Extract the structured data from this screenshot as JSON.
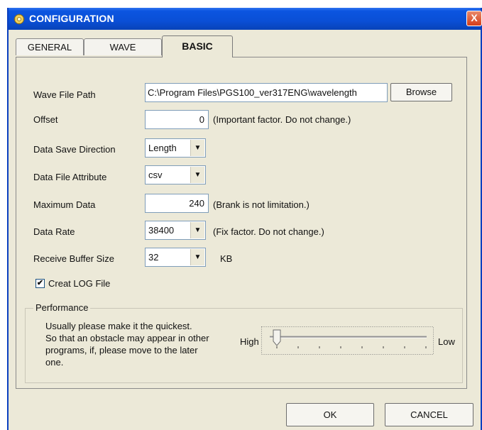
{
  "window": {
    "title": "CONFIGURATION",
    "close_label": "X"
  },
  "tabs": [
    {
      "label": "GENERAL"
    },
    {
      "label": "WAVE"
    },
    {
      "label": "BASIC",
      "active": true
    }
  ],
  "basic": {
    "wave_file_path": {
      "label": "Wave File Path",
      "value": "C:\\Program Files\\PGS100_ver317ENG\\wavelength",
      "browse_label": "Browse"
    },
    "offset": {
      "label": "Offset",
      "value": "0",
      "note": "(Important factor. Do not change.)"
    },
    "data_save_direction": {
      "label": "Data Save Direction",
      "value": "Length"
    },
    "data_file_attribute": {
      "label": "Data File Attribute",
      "value": "csv"
    },
    "maximum_data": {
      "label": "Maximum Data",
      "value": "240",
      "note": "(Brank is not limitation.)"
    },
    "data_rate": {
      "label": "Data Rate",
      "value": "38400",
      "note": "(Fix factor. Do not change.)"
    },
    "receive_buffer_size": {
      "label": "Receive Buffer Size",
      "value": "32",
      "unit": "KB"
    },
    "create_log": {
      "label": "Creat LOG File",
      "checked": true,
      "check_mark": "✔"
    }
  },
  "performance": {
    "title": "Performance",
    "description_lines": [
      "Usually please make it the quickest.",
      "So that an obstacle may appear in other",
      "programs, if, please move to the later",
      "one."
    ],
    "high_label": "High",
    "low_label": "Low",
    "slider_position": 0
  },
  "footer": {
    "ok_label": "OK",
    "cancel_label": "CANCEL"
  },
  "colors": {
    "titlebar": "#0a4fd6",
    "dialog_bg": "#ece9d8",
    "close_button": "#d43d1a"
  },
  "icons": {
    "title": "gear-icon",
    "combo_arrow": "▼"
  }
}
